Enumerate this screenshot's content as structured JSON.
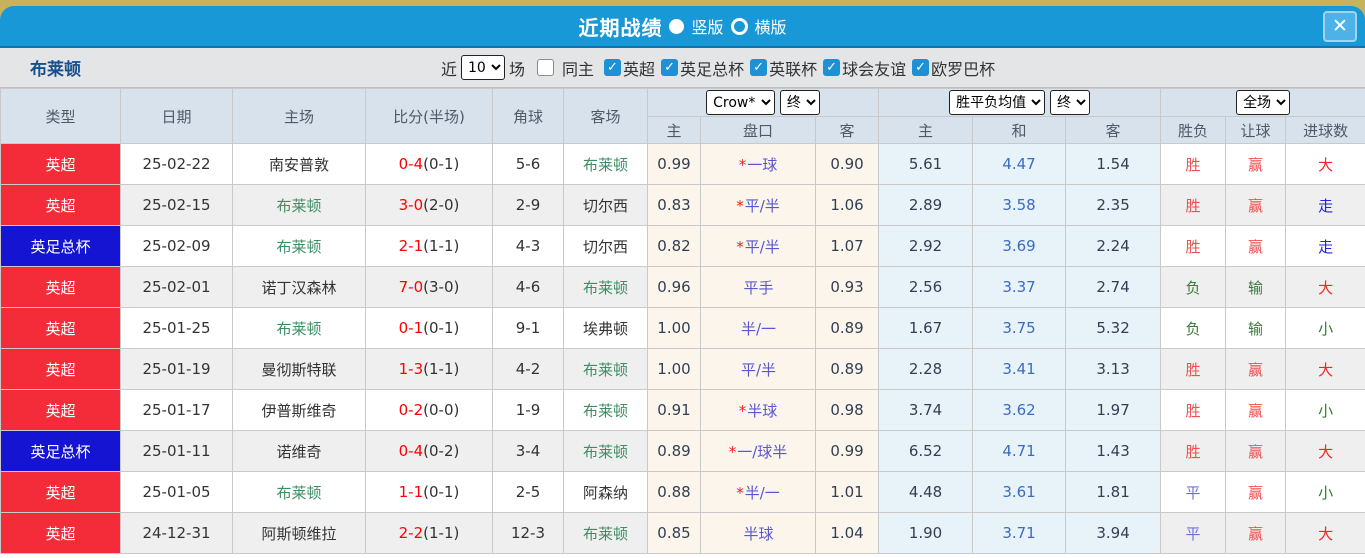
{
  "titlebar": {
    "title": "近期战绩",
    "radio_vertical_label": "竖版",
    "radio_horizontal_label": "横版",
    "close_label": "✕"
  },
  "filter": {
    "team": "布莱顿",
    "recent_label": "近",
    "recent_value": "10",
    "matches_label": "场",
    "same_venue_label": "同主",
    "competitions": [
      "英超",
      "英足总杯",
      "英联杯",
      "球会友谊",
      "欧罗巴杯"
    ]
  },
  "table": {
    "headers_left": [
      "类型",
      "日期",
      "主场",
      "比分(半场)",
      "角球",
      "客场"
    ],
    "group_selects": {
      "bookmaker": "Crow*",
      "bookmaker_state": "终",
      "avg": "胜平负均值",
      "avg_state": "终",
      "scope": "全场"
    },
    "headers_sub": [
      "主",
      "盘口",
      "客",
      "主",
      "和",
      "客",
      "胜负",
      "让球",
      "进球数"
    ],
    "rows": [
      {
        "type": "英超",
        "date": "25-02-22",
        "home": "南安普敦",
        "score_ft": "0-4",
        "score_ht": "(0-1)",
        "corners": "5-6",
        "away": "布莱顿",
        "h_home": "0.99",
        "line_star": true,
        "line": "一球",
        "h_away": "0.90",
        "w": "5.61",
        "d": "4.47",
        "l": "1.54",
        "res_wdl": "胜",
        "res_handicap": "赢",
        "res_goals": "大"
      },
      {
        "type": "英超",
        "date": "25-02-15",
        "home": "布莱顿",
        "score_ft": "3-0",
        "score_ht": "(2-0)",
        "corners": "2-9",
        "away": "切尔西",
        "h_home": "0.83",
        "line_star": true,
        "line": "平/半",
        "h_away": "1.06",
        "w": "2.89",
        "d": "3.58",
        "l": "2.35",
        "res_wdl": "胜",
        "res_handicap": "赢",
        "res_goals": "走"
      },
      {
        "type": "英足总杯",
        "date": "25-02-09",
        "home": "布莱顿",
        "score_ft": "2-1",
        "score_ht": "(1-1)",
        "corners": "4-3",
        "away": "切尔西",
        "h_home": "0.82",
        "line_star": true,
        "line": "平/半",
        "h_away": "1.07",
        "w": "2.92",
        "d": "3.69",
        "l": "2.24",
        "res_wdl": "胜",
        "res_handicap": "赢",
        "res_goals": "走"
      },
      {
        "type": "英超",
        "date": "25-02-01",
        "home": "诺丁汉森林",
        "score_ft": "7-0",
        "score_ht": "(3-0)",
        "corners": "4-6",
        "away": "布莱顿",
        "h_home": "0.96",
        "line_star": false,
        "line": "平手",
        "h_away": "0.93",
        "w": "2.56",
        "d": "3.37",
        "l": "2.74",
        "res_wdl": "负",
        "res_handicap": "输",
        "res_goals": "大"
      },
      {
        "type": "英超",
        "date": "25-01-25",
        "home": "布莱顿",
        "score_ft": "0-1",
        "score_ht": "(0-1)",
        "corners": "9-1",
        "away": "埃弗顿",
        "h_home": "1.00",
        "line_star": false,
        "line": "半/一",
        "h_away": "0.89",
        "w": "1.67",
        "d": "3.75",
        "l": "5.32",
        "res_wdl": "负",
        "res_handicap": "输",
        "res_goals": "小"
      },
      {
        "type": "英超",
        "date": "25-01-19",
        "home": "曼彻斯特联",
        "score_ft": "1-3",
        "score_ht": "(1-1)",
        "corners": "4-2",
        "away": "布莱顿",
        "h_home": "1.00",
        "line_star": false,
        "line": "平/半",
        "h_away": "0.89",
        "w": "2.28",
        "d": "3.41",
        "l": "3.13",
        "res_wdl": "胜",
        "res_handicap": "赢",
        "res_goals": "大"
      },
      {
        "type": "英超",
        "date": "25-01-17",
        "home": "伊普斯维奇",
        "score_ft": "0-2",
        "score_ht": "(0-0)",
        "corners": "1-9",
        "away": "布莱顿",
        "h_home": "0.91",
        "line_star": true,
        "line": "半球",
        "h_away": "0.98",
        "w": "3.74",
        "d": "3.62",
        "l": "1.97",
        "res_wdl": "胜",
        "res_handicap": "赢",
        "res_goals": "小"
      },
      {
        "type": "英足总杯",
        "date": "25-01-11",
        "home": "诺维奇",
        "score_ft": "0-4",
        "score_ht": "(0-2)",
        "corners": "3-4",
        "away": "布莱顿",
        "h_home": "0.89",
        "line_star": true,
        "line": "一/球半",
        "h_away": "0.99",
        "w": "6.52",
        "d": "4.71",
        "l": "1.43",
        "res_wdl": "胜",
        "res_handicap": "赢",
        "res_goals": "大"
      },
      {
        "type": "英超",
        "date": "25-01-05",
        "home": "布莱顿",
        "score_ft": "1-1",
        "score_ht": "(0-1)",
        "corners": "2-5",
        "away": "阿森纳",
        "h_home": "0.88",
        "line_star": true,
        "line": "半/一",
        "h_away": "1.01",
        "w": "4.48",
        "d": "3.61",
        "l": "1.81",
        "res_wdl": "平",
        "res_handicap": "赢",
        "res_goals": "小"
      },
      {
        "type": "英超",
        "date": "24-12-31",
        "home": "阿斯顿维拉",
        "score_ft": "2-2",
        "score_ht": "(1-1)",
        "corners": "12-3",
        "away": "布莱顿",
        "h_home": "0.85",
        "line_star": false,
        "line": "半球",
        "h_away": "1.04",
        "w": "1.90",
        "d": "3.71",
        "l": "3.94",
        "res_wdl": "平",
        "res_handicap": "赢",
        "res_goals": "大"
      }
    ]
  },
  "colors": {
    "league": {
      "英超": "#f42c3a",
      "英足总杯": "#1414d2"
    },
    "result": {
      "胜": "#ef4f4f",
      "负": "#3c7a3c",
      "平": "#7070dc",
      "赢": "#ef4f4f",
      "输": "#3c7a3c",
      "大": "#f32525",
      "小": "#2e7d32",
      "走": "#2424dd"
    },
    "accent_blue": "#1898d6",
    "checkbox_blue": "#1e90d6",
    "focus_team_green": "#3d8f63",
    "handicap_line_violet": "#5b57d0",
    "score_red": "#ff0000"
  }
}
